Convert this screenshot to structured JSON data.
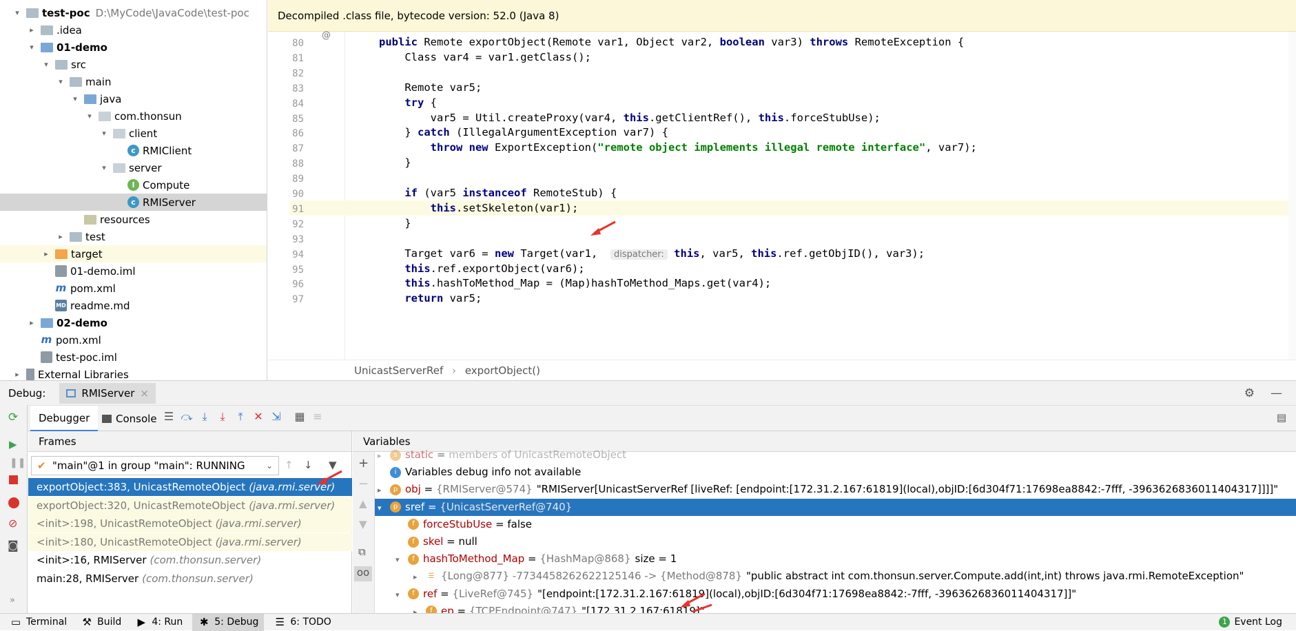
{
  "tree": {
    "items": [
      {
        "label": "test-poc",
        "path": "D:\\MyCode\\JavaCode\\test-poc",
        "bold": true,
        "indent": 0,
        "arrow": "▾",
        "icon": "folder",
        "row": 0
      },
      {
        "label": ".idea",
        "indent": 1,
        "arrow": "▸",
        "icon": "folder",
        "row": 1
      },
      {
        "label": "01-demo",
        "bold": true,
        "indent": 1,
        "arrow": "▾",
        "icon": "folder-blue",
        "row": 2
      },
      {
        "label": "src",
        "indent": 2,
        "arrow": "▾",
        "icon": "folder",
        "row": 3
      },
      {
        "label": "main",
        "indent": 3,
        "arrow": "▾",
        "icon": "folder",
        "row": 4
      },
      {
        "label": "java",
        "indent": 4,
        "arrow": "▾",
        "icon": "folder-blue",
        "row": 5
      },
      {
        "label": "com.thonsun",
        "indent": 5,
        "arrow": "▾",
        "icon": "package",
        "row": 6
      },
      {
        "label": "client",
        "indent": 6,
        "arrow": "▾",
        "icon": "package",
        "row": 7
      },
      {
        "label": "RMIClient",
        "indent": 7,
        "arrow": "",
        "icon": "class",
        "row": 8
      },
      {
        "label": "server",
        "indent": 6,
        "arrow": "▾",
        "icon": "package",
        "row": 9
      },
      {
        "label": "Compute",
        "indent": 7,
        "arrow": "",
        "icon": "interface",
        "row": 10
      },
      {
        "label": "RMIServer",
        "indent": 7,
        "arrow": "",
        "icon": "class",
        "row": 11,
        "selected": true
      },
      {
        "label": "resources",
        "indent": 4,
        "arrow": "",
        "icon": "resources",
        "row": 12
      },
      {
        "label": "test",
        "indent": 3,
        "arrow": "▸",
        "icon": "folder",
        "row": 13
      },
      {
        "label": "target",
        "indent": 2,
        "arrow": "▸",
        "icon": "folder-orange",
        "row": 14,
        "yellow": true
      },
      {
        "label": "01-demo.iml",
        "indent": 2,
        "arrow": "",
        "icon": "iml",
        "row": 15
      },
      {
        "label": "pom.xml",
        "indent": 2,
        "arrow": "",
        "icon": "maven",
        "row": 16
      },
      {
        "label": "readme.md",
        "indent": 2,
        "arrow": "",
        "icon": "md",
        "row": 17
      },
      {
        "label": "02-demo",
        "bold": true,
        "indent": 1,
        "arrow": "▸",
        "icon": "folder-blue",
        "row": 18
      },
      {
        "label": "pom.xml",
        "indent": 1,
        "arrow": "",
        "icon": "maven",
        "row": 19
      },
      {
        "label": "test-poc.iml",
        "indent": 1,
        "arrow": "",
        "icon": "iml",
        "row": 20
      },
      {
        "label": "External Libraries",
        "indent": 0,
        "arrow": "▸",
        "icon": "library",
        "row": 21
      }
    ]
  },
  "editor": {
    "banner": "Decompiled .class file, bytecode version: 52.0 (Java 8)",
    "lines": [
      {
        "n": "80",
        "html": "<span class='kw'>public</span> Remote exportObject(Remote var1, Object var2, <span class='kw'>boolean</span> var3) <span class='kw'>throws</span> RemoteException {"
      },
      {
        "n": "81",
        "html": "    Class var4 = var1.getClass();"
      },
      {
        "n": "82",
        "html": ""
      },
      {
        "n": "83",
        "html": "    Remote var5;"
      },
      {
        "n": "84",
        "html": "    <span class='kw'>try</span> {"
      },
      {
        "n": "85",
        "html": "        var5 = Util.createProxy(var4, <span class='kw'>this</span>.getClientRef(), <span class='kw'>this</span>.forceStubUse);"
      },
      {
        "n": "86",
        "html": "    } <span class='kw'>catch</span> (IllegalArgumentException var7) {"
      },
      {
        "n": "87",
        "html": "        <span class='kw'>throw new</span> ExportException(<span class='str'>\"remote object implements illegal remote interface\"</span>, var7);"
      },
      {
        "n": "88",
        "html": "    }"
      },
      {
        "n": "89",
        "html": ""
      },
      {
        "n": "90",
        "html": "    <span class='kw'>if</span> (var5 <span class='kw'>instanceof</span> RemoteStub) {"
      },
      {
        "n": "91",
        "html": "        <span class='kw'>this</span>.setSkeleton(var1);",
        "hl": true
      },
      {
        "n": "92",
        "html": "    }"
      },
      {
        "n": "93",
        "html": ""
      },
      {
        "n": "94",
        "html": "    Target var6 = <span class='kw'>new</span> Target(var1,  <span class='hint'>dispatcher:</span> <span class='kw'>this</span>, var5, <span class='kw'>this</span>.ref.getObjID(), var3);"
      },
      {
        "n": "95",
        "html": "    <span class='kw'>this</span>.ref.exportObject(var6);"
      },
      {
        "n": "96",
        "html": "    <span class='kw'>this</span>.hashToMethod_Map = (Map)hashToMethod_Maps.get(var4);"
      },
      {
        "n": "97",
        "html": "    <span class='kw'>return</span> var5;"
      }
    ],
    "breadcrumb_class": "UnicastServerRef",
    "breadcrumb_method": "exportObject()"
  },
  "debug": {
    "label": "Debug:",
    "config_tab": "RMIServer",
    "tab_debugger": "Debugger",
    "tab_console": "Console",
    "frames_header": "Frames",
    "variables_header": "Variables",
    "thread": "\"main\"@1 in group \"main\": RUNNING",
    "frames": [
      {
        "method": "exportObject:383, UnicastRemoteObject",
        "pkg": "(java.rmi.server)",
        "style": "sel"
      },
      {
        "method": "exportObject:320, UnicastRemoteObject",
        "pkg": "(java.rmi.server)",
        "style": "yel"
      },
      {
        "method": "<init>:198, UnicastRemoteObject",
        "pkg": "(java.rmi.server)",
        "style": "yel"
      },
      {
        "method": "<init>:180, UnicastRemoteObject",
        "pkg": "(java.rmi.server)",
        "style": "yel"
      },
      {
        "method": "<init>:16, RMIServer",
        "pkg": "(com.thonsun.server)",
        "style": ""
      },
      {
        "method": "main:28, RMIServer",
        "pkg": "(com.thonsun.server)",
        "style": ""
      }
    ],
    "variables": [
      {
        "indent": 0,
        "arrow": "▸",
        "icon": "s",
        "name": "static",
        "type": "members of UnicastRemoteObject",
        "value": "",
        "partial": true
      },
      {
        "indent": 0,
        "arrow": "",
        "icon": "info",
        "name": "",
        "type": "",
        "value": "Variables debug info not available"
      },
      {
        "indent": 0,
        "arrow": "▸",
        "icon": "p",
        "name": "obj",
        "type": "{RMIServer@574}",
        "value": "\"RMIServer[UnicastServerRef [liveRef: [endpoint:[172.31.2.167:61819](local),objID:[6d304f71:17698ea8842:-7fff, -3963626836011404317]]]]\""
      },
      {
        "indent": 0,
        "arrow": "▾",
        "icon": "p",
        "name": "sref",
        "type": "{UnicastServerRef@740}",
        "value": "",
        "selected": true
      },
      {
        "indent": 1,
        "arrow": "",
        "icon": "f",
        "name": "forceStubUse",
        "type": "",
        "value": "false"
      },
      {
        "indent": 1,
        "arrow": "",
        "icon": "f",
        "name": "skel",
        "type": "",
        "value": "null"
      },
      {
        "indent": 1,
        "arrow": "▾",
        "icon": "f",
        "name": "hashToMethod_Map",
        "type": "{HashMap@868}",
        "value": "size = 1"
      },
      {
        "indent": 2,
        "arrow": "▸",
        "icon": "e",
        "name": "",
        "type": "{Long@877} -7734458262622125146 -> {Method@878}",
        "value": "\"public abstract int com.thonsun.server.Compute.add(int,int) throws java.rmi.RemoteException\""
      },
      {
        "indent": 1,
        "arrow": "▾",
        "icon": "f",
        "name": "ref",
        "type": "{LiveRef@745}",
        "value": "\"[endpoint:[172.31.2.167:61819](local),objID:[6d304f71:17698ea8842:-7fff, -3963626836011404317]]\""
      },
      {
        "indent": 2,
        "arrow": "▸",
        "icon": "f",
        "name": "ep",
        "type": "{TCPEndpoint@747}",
        "value": "\"[172.31.2.167:61819]\""
      }
    ]
  },
  "statusbar": {
    "terminal": "Terminal",
    "build": "Build",
    "run": "4: Run",
    "debug": "5: Debug",
    "todo": "6: TODO",
    "eventlog": "Event Log",
    "eventlog_count": "1"
  },
  "colors": {
    "selection": "#2675bf",
    "keyword": "#000080",
    "string": "#008000",
    "yellow_bg": "#fcfae2"
  }
}
